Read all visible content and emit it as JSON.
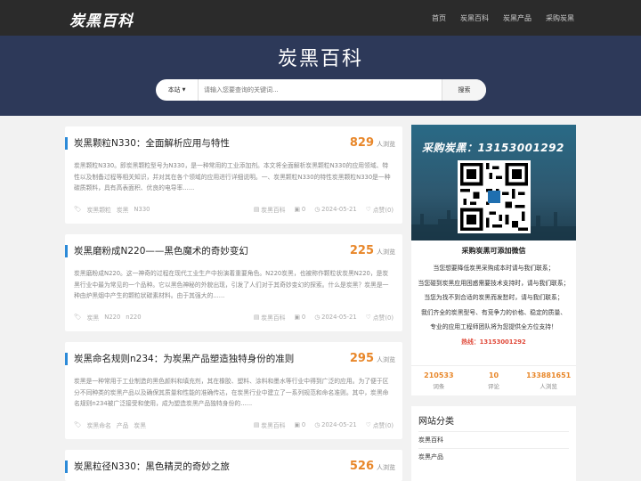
{
  "header": {
    "logo": "炭黑百科",
    "nav": [
      "首页",
      "炭黑百科",
      "炭黑产品",
      "采购炭黑"
    ]
  },
  "hero": {
    "title": "炭黑百科",
    "search": {
      "scope_label": "本站",
      "placeholder": "请输入您要查询的关键词...",
      "button_label": "搜索"
    }
  },
  "articles": [
    {
      "title": "炭黑颗粒N330：全面解析应用与特性",
      "views": "829",
      "views_unit": "人浏览",
      "excerpt": "炭黑颗粒N330。即炭黑颗粒型号为N330，是一种常用的工业添加剂。本文将全面解析炭黑颗粒N330的应用领域、特性以及制备过程等相关知识，并对其在各个领域的应用进行详细说明。一、炭黑颗粒N330的特性炭黑颗粒N330是一种碳质颗料，具有高表面积、优良的电导率......",
      "tags": [
        "炭黑颗粒",
        "炭黑",
        "N330"
      ],
      "category": "炭黑百科",
      "comments": "0",
      "date": "2024-05-21",
      "likes": "点赞(0)"
    },
    {
      "title": "炭黑磨粉成N220——黑色魔术的奇妙变幻",
      "views": "225",
      "views_unit": "人浏览",
      "excerpt": "炭黑磨粉成N220。这一神奇的过程在现代工业生产中扮演着重要角色。N220炭黑，也被称作颗粒状炭黑N220，是炭黑行业中最为常见的一个品种。它以黑色神秘的外貌出现，引发了人们对于其奇妙变幻的探索。什么是炭黑？炭黑是一种由炉黑烟中产生的颗粒状碳素材料。由于其强大的......",
      "tags": [
        "炭黑",
        "N220",
        "n220"
      ],
      "category": "炭黑百科",
      "comments": "0",
      "date": "2024-05-21",
      "likes": "点赞(0)"
    },
    {
      "title": "炭黑命名规则n234：为炭黑产品塑造独特身份的准则",
      "views": "295",
      "views_unit": "人浏览",
      "excerpt": "炭黑是一种常用于工业制造的黑色颜料和填充剂，其在橡胶、塑料、涂料和墨水等行业中得到广泛的应用。为了便于区分不同种类的炭黑产品以及确保其质量和性能的准确传达，在炭黑行业中建立了一系列规范和命名准则。其中，炭黑命名规则n234被广泛接受和使用，成为塑造炭黑产品独特身份的......",
      "tags": [
        "炭黑命名",
        "产品",
        "炭黑"
      ],
      "category": "炭黑百科",
      "comments": "0",
      "date": "2024-05-21",
      "likes": "点赞(0)"
    },
    {
      "title": "炭黑粒径N330：黑色精灵的奇妙之旅",
      "views": "526",
      "views_unit": "人浏览"
    }
  ],
  "sidebar": {
    "banner_text": "采购炭黑：13153001292",
    "qr_label": "炭黑百科",
    "heading": "采购炭黑可添加微信",
    "lines": [
      "当您想要降低炭黑采购成本时请与我们联系；",
      "当您碰到炭黑应用困惑需要技术支持时，请与我们联系；",
      "当您为找不到合适的炭黑而发愁时，请与我们联系；",
      "我们齐全的炭黑型号、有竞争力的价格、稳定的质量、",
      "专业的应用工程师团队将为您提供全方位支持！"
    ],
    "hotline": "热线：13153001292",
    "stats": [
      {
        "value": "210533",
        "label": "词条"
      },
      {
        "value": "10",
        "label": "评论"
      },
      {
        "value": "133881651",
        "label": "人浏览"
      }
    ],
    "categories_title": "网站分类",
    "categories": [
      "炭黑百科",
      "炭黑产品"
    ]
  },
  "colors": {
    "accent": "#2b8ad8",
    "views": "#e8872a",
    "hotline": "#e04a3a",
    "hero": "#2d3959",
    "topbar": "#2b2b2b"
  }
}
